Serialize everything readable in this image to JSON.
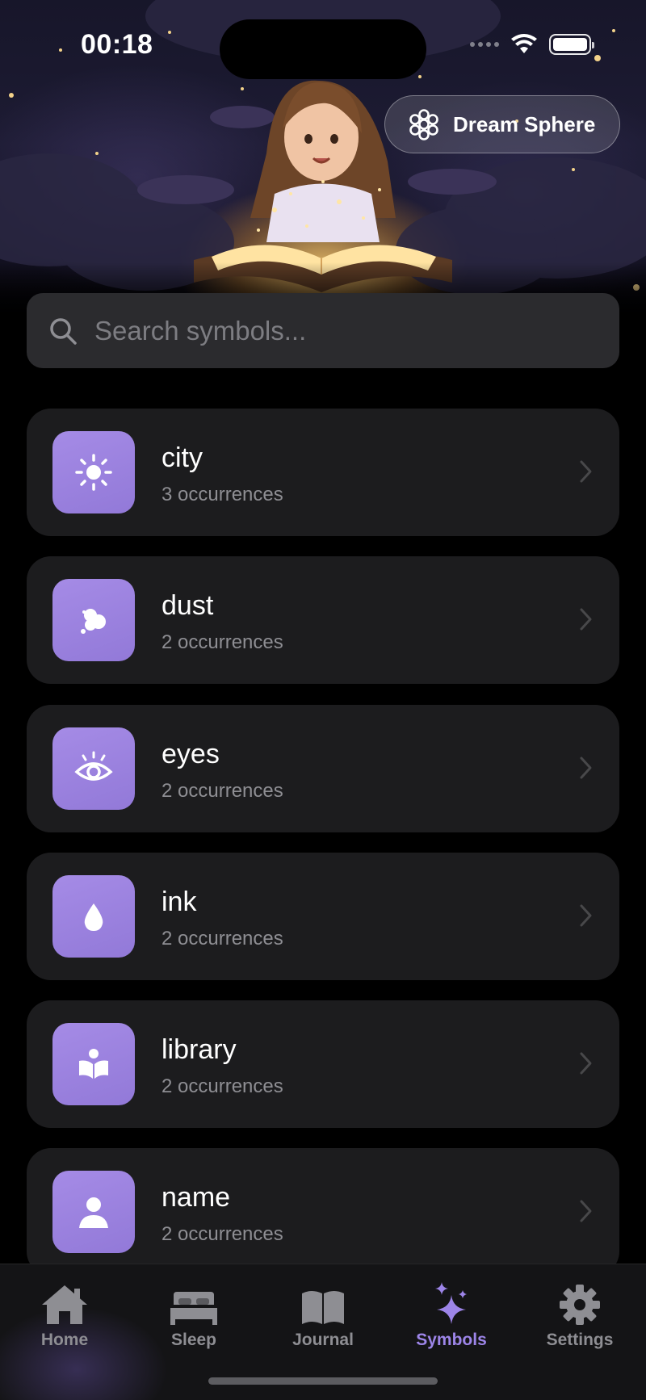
{
  "status_bar": {
    "time": "00:18",
    "icons": [
      "wifi-icon",
      "battery-icon"
    ]
  },
  "hero": {
    "illustration": "girl reading a glowing book among clouds and stars"
  },
  "header": {
    "app_badge_label": "Dream Sphere",
    "app_badge_icon": "flower-cluster-icon"
  },
  "search": {
    "placeholder": "Search symbols...",
    "value": ""
  },
  "symbols": [
    {
      "name": "city",
      "occurrences": "3 occurrences",
      "icon": "sun-icon"
    },
    {
      "name": "dust",
      "occurrences": "2 occurrences",
      "icon": "particles-icon"
    },
    {
      "name": "eyes",
      "occurrences": "2 occurrences",
      "icon": "eye-icon"
    },
    {
      "name": "ink",
      "occurrences": "2 occurrences",
      "icon": "drop-icon"
    },
    {
      "name": "library",
      "occurrences": "2 occurrences",
      "icon": "book-reader-icon"
    },
    {
      "name": "name",
      "occurrences": "2 occurrences",
      "icon": "person-icon"
    }
  ],
  "tab_bar": {
    "tabs": [
      {
        "label": "Home",
        "icon": "house-icon",
        "active": false
      },
      {
        "label": "Sleep",
        "icon": "bed-icon",
        "active": false
      },
      {
        "label": "Journal",
        "icon": "book-icon",
        "active": false
      },
      {
        "label": "Symbols",
        "icon": "sparkles-icon",
        "active": true
      },
      {
        "label": "Settings",
        "icon": "gear-icon",
        "active": false
      }
    ]
  },
  "colors": {
    "accent": "#9d85e8",
    "tile": "#9a82dd",
    "card": "#1c1c1e",
    "search_bg": "#2b2b2e",
    "inactive_tab": "#8e8e93"
  }
}
